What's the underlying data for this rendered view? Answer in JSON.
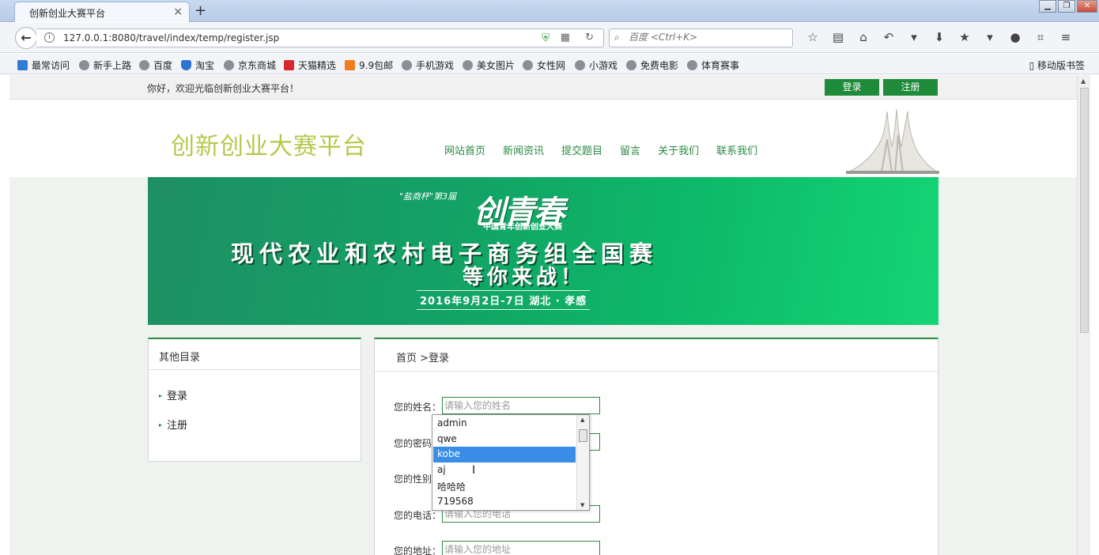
{
  "browser": {
    "tab_title": "创新创业大赛平台",
    "tab_close": "×",
    "new_tab": "+",
    "url": "127.0.0.1:8080/travel/index/temp/register.jsp",
    "search_placeholder": "百度 <Ctrl+K>",
    "bookmarks": [
      "最常访问",
      "新手上路",
      "百度",
      "淘宝",
      "京东商城",
      "天猫精选",
      "9.9包邮",
      "手机游戏",
      "美女图片",
      "女性网",
      "小游戏",
      "免费电影",
      "体育赛事"
    ],
    "mobile_bookmarks": "移动版书签"
  },
  "page": {
    "welcome": "你好，欢迎光临创新创业大赛平台！",
    "login_button": "登录",
    "register_button": "注册",
    "site_title": "创新创业大赛平台",
    "nav": [
      "网站首页",
      "新闻资讯",
      "提交题目",
      "留言",
      "关于我们",
      "联系我们"
    ],
    "banner": {
      "sub": "\"盐商杯\"第3届",
      "brand": "创青春",
      "brand_sub": "中国青年创新创业大赛",
      "line1": "现代农业和农村电子商务组全国赛",
      "line2": "等你来战！",
      "date": "2016年9月2日-7日  湖北 · 孝感"
    },
    "sidebar": {
      "title": "其他目录",
      "items": [
        "登录",
        "注册"
      ]
    },
    "breadcrumb": "首页 >登录",
    "form": {
      "name_label": "您的姓名：",
      "name_placeholder": "请输入您的姓名",
      "password_label": "您的密码：",
      "gender_label": "您的性别：",
      "phone_label": "您的电话：",
      "phone_placeholder": "请输入您的电话",
      "address_label": "您的地址：",
      "address_placeholder": "请输入您的地址"
    },
    "autocomplete": {
      "items": [
        "admin",
        "qwe",
        "kobe",
        "aj",
        "哈哈哈",
        "719568"
      ],
      "selected": "kobe"
    }
  }
}
